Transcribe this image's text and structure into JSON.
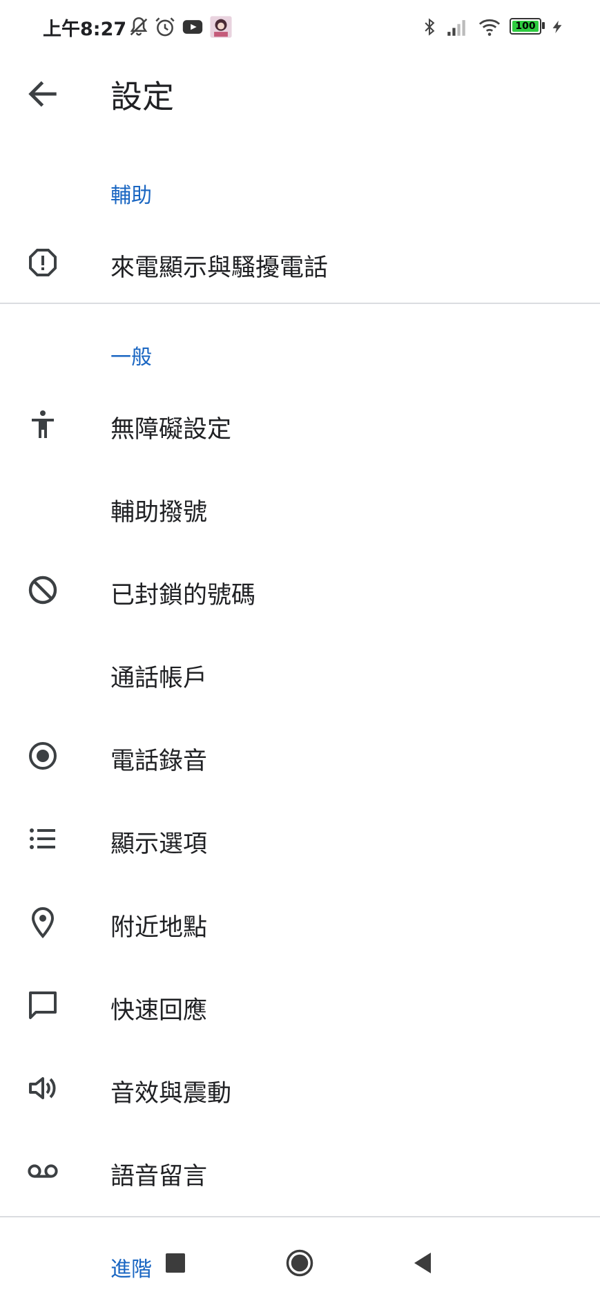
{
  "status_bar": {
    "time": "上午8:27",
    "battery": "100",
    "icons": [
      "mute-icon",
      "alarm-icon",
      "youtube-icon",
      "avatar",
      "bluetooth-icon",
      "signal-icon",
      "wifi-icon",
      "battery-icon",
      "charging-icon"
    ]
  },
  "app_bar": {
    "title": "設定"
  },
  "sections": [
    {
      "header": "輔助",
      "items": [
        {
          "label": "來電顯示與騷擾電話",
          "icon": "alert-octagon-icon"
        }
      ]
    },
    {
      "header": "一般",
      "items": [
        {
          "label": "無障礙設定",
          "icon": "accessibility-icon"
        },
        {
          "label": "輔助撥號",
          "icon": ""
        },
        {
          "label": "已封鎖的號碼",
          "icon": "block-icon"
        },
        {
          "label": "通話帳戶",
          "icon": ""
        },
        {
          "label": "電話錄音",
          "icon": "record-icon"
        },
        {
          "label": "顯示選項",
          "icon": "list-icon"
        },
        {
          "label": "附近地點",
          "icon": "location-pin-icon"
        },
        {
          "label": "快速回應",
          "icon": "chat-bubble-icon"
        },
        {
          "label": "音效與震動",
          "icon": "volume-icon"
        },
        {
          "label": "語音留言",
          "icon": "voicemail-icon"
        }
      ]
    }
  ],
  "footer": {
    "advanced": "進階"
  },
  "colors": {
    "accent": "#1a66c2",
    "text": "#202124",
    "icon": "#3c4043",
    "divider": "#dadce0"
  }
}
